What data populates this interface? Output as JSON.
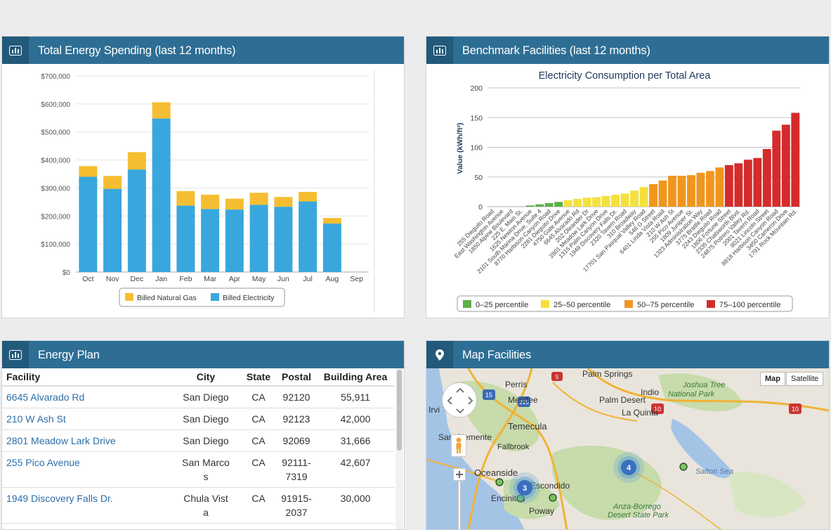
{
  "spending": {
    "title": "Total Energy Spending (last 12 months)",
    "chart_data": {
      "type": "bar",
      "stacked": true,
      "categories": [
        "Oct",
        "Nov",
        "Dec",
        "Jan",
        "Feb",
        "Mar",
        "Apr",
        "May",
        "Jun",
        "Jul",
        "Aug",
        "Sep"
      ],
      "series": [
        {
          "name": "Billed Electricity",
          "color": "#39a7dd",
          "values": [
            340000,
            297000,
            366000,
            548000,
            237000,
            225000,
            223000,
            240000,
            233000,
            252000,
            173000,
            0
          ]
        },
        {
          "name": "Billed Natural Gas",
          "color": "#f5be32",
          "values": [
            38000,
            46000,
            62000,
            58000,
            52000,
            51000,
            39000,
            43000,
            35000,
            34000,
            20000,
            0
          ]
        }
      ],
      "y_ticks": [
        "$0",
        "$100,000",
        "$200,000",
        "$300,000",
        "$400,000",
        "$500,000",
        "$600,000",
        "$700,000"
      ],
      "ylim": [
        0,
        700000
      ],
      "legend": [
        "Billed Natural Gas",
        "Billed Electricity"
      ],
      "legend_position": "bottom",
      "grid": true
    }
  },
  "benchmark": {
    "title": "Benchmark Facilities  (last 12 months)",
    "chart_data": {
      "type": "bar",
      "title": "Electricity Consumption per Total Area",
      "ylabel": "Value (kWh/ft²)",
      "ylim": [
        0,
        200
      ],
      "y_ticks": [
        "0",
        "50",
        "100",
        "150",
        "200"
      ],
      "categories": [
        "255 Dieguito Road",
        "East Washington Avenue",
        "1850 Alpine Boulevard",
        "225 E. Main St.",
        "1625 Newton Avenue",
        "2101 South Marina Drive, Suite 4",
        "8770 Harbison Canyon Road",
        "2281 Dieguito Drive",
        "4750 Gate Avenue",
        "6645 Alvarado Rd",
        "202 Oleander Dr",
        "2801 Meadow Lark Drive",
        "1315 Palm Canyon Drive",
        "1949 Discovery Falls Dr.",
        "2320 Tavern Road",
        "310 Broadway",
        "17701 San Pasqual Valley Road",
        "546 G Street",
        "6401 Linda Vista Road",
        "210 W Ash St",
        "255 Pico Avenue",
        "1809 Juniper St.",
        "1323 Administration Way",
        "3775 Brattle Road",
        "2243 Dieguito Road",
        "1806 Fortune Street",
        "2335 Chatsworth Blvd.",
        "24875 Potrero Valley Rd.",
        "2001 Tavern Road",
        "8021 Lincoln Street",
        "8818 Harbison Canyon Road",
        "3450 Cameron Drive",
        "1791 Rock Mountain Rd."
      ],
      "values": [
        0,
        0,
        0,
        0,
        2,
        4,
        6,
        8,
        11,
        13,
        15,
        16,
        18,
        20,
        22,
        27,
        33,
        38,
        44,
        52,
        52,
        53,
        57,
        60,
        66,
        70,
        73,
        79,
        82,
        97,
        128,
        138,
        158
      ],
      "colors": [
        "#5cb048",
        "#5cb048",
        "#5cb048",
        "#5cb048",
        "#5cb048",
        "#5cb048",
        "#5cb048",
        "#5cb048",
        "#f5e03d",
        "#f5e03d",
        "#f5e03d",
        "#f5e03d",
        "#f5e03d",
        "#f5e03d",
        "#f5e03d",
        "#f5e03d",
        "#f5e03d",
        "#f0961e",
        "#f0961e",
        "#f0961e",
        "#f0961e",
        "#f0961e",
        "#f0961e",
        "#f0961e",
        "#f0961e",
        "#d42b2b",
        "#d42b2b",
        "#d42b2b",
        "#d42b2b",
        "#d42b2b",
        "#d42b2b",
        "#d42b2b",
        "#d42b2b"
      ],
      "legend": [
        {
          "name": "0–25 percentile",
          "color": "#5cb048"
        },
        {
          "name": "25–50 percentile",
          "color": "#f5e03d"
        },
        {
          "name": "50–75 percentile",
          "color": "#f0961e"
        },
        {
          "name": "75–100 percentile",
          "color": "#d42b2b"
        }
      ]
    }
  },
  "plan": {
    "title": "Energy Plan",
    "columns": [
      "Facility",
      "City",
      "State",
      "Postal",
      "Building Area"
    ],
    "rows": [
      {
        "facility": "6645 Alvarado Rd",
        "city": "San Diego",
        "state": "CA",
        "postal": "92120",
        "area": "55,911"
      },
      {
        "facility": "210 W Ash St",
        "city": "San Diego",
        "state": "CA",
        "postal": "92123",
        "area": "42,000"
      },
      {
        "facility": "2801 Meadow Lark Drive",
        "city": "San Diego",
        "state": "CA",
        "postal": "92069",
        "area": "31,666"
      },
      {
        "facility": "255 Pico Avenue",
        "city": "San Marcos",
        "state": "CA",
        "postal": "92111-7319",
        "area": "42,607"
      },
      {
        "facility": "1949 Discovery Falls Dr.",
        "city": "Chula Vista",
        "state": "CA",
        "postal": "91915-2037",
        "area": "30,000"
      }
    ]
  },
  "map": {
    "title": "Map Facilities",
    "map_button": "Map",
    "satellite_button": "Satellite",
    "places": [
      "Palm Springs",
      "Perris",
      "Joshua Tree",
      "National Park",
      "Indio",
      "Menifee",
      "Palm Desert",
      "La Quinta",
      "Temecula",
      "Fallbrook",
      "Oceanside",
      "Escondido",
      "Encinitas",
      "Poway",
      "Salton Sea",
      "Anza-Borrego",
      "Desert State Park",
      "Irvi",
      "San Clemente"
    ],
    "highways": [
      "15",
      "215",
      "10",
      "10",
      "5"
    ],
    "clusters": [
      {
        "count": "4"
      },
      {
        "count": "3"
      }
    ]
  }
}
